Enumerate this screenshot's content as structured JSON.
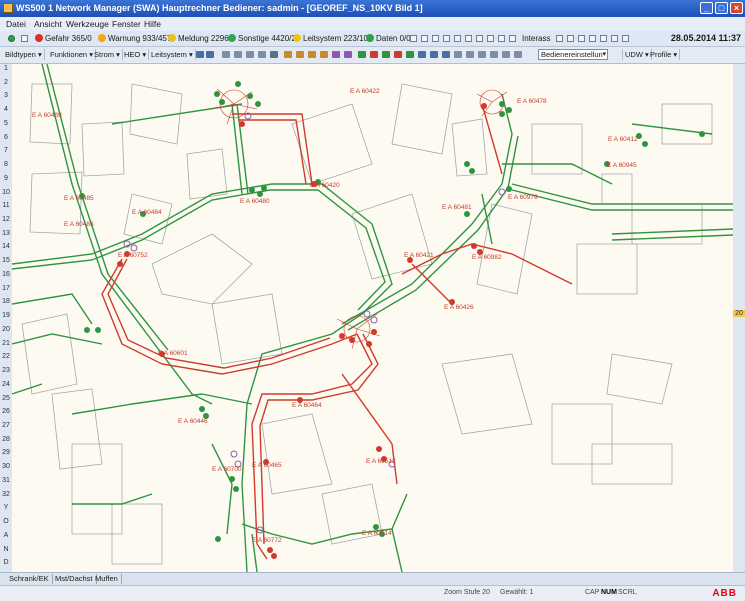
{
  "window": {
    "title": "WS500 1 Network Manager (SWA) Hauptrechner Bediener: sadmin - [GEOREF_NS_10KV     Bild 1]",
    "minimize": "_",
    "maximize": "□",
    "close": "×"
  },
  "menu": [
    "Datei",
    "Ansicht",
    "Werkzeuge",
    "Fenster",
    "Hilfe"
  ],
  "status": {
    "gefahr": "Gefahr 365/0",
    "warnung": "Warnung 933/457",
    "meldung": "Meldung 2296/0",
    "sonstige": "Sonstige 4420/2",
    "leitsystem": "Leitsystem 223/104",
    "daten": "Daten 0/0",
    "interass": "Interass",
    "datetime": "28.05.2014  11:37",
    "colors": {
      "gefahr": "#d93025",
      "warnung": "#f4a31b",
      "meldung": "#e8c21e",
      "sonstige": "#2fa84f",
      "leitsystem": "#e6c619",
      "daten": "#2f9e44"
    }
  },
  "toolbar": {
    "menus": [
      "Bildtypen",
      "Funktionen",
      "Strom",
      "HEO",
      "Leitsystem"
    ],
    "select_value": "Bedienereinstellun",
    "udw": "UDW",
    "profile": "Profile"
  },
  "ruler": {
    "left": [
      "1",
      "2",
      "3",
      "4",
      "5",
      "6",
      "7",
      "8",
      "9",
      "10",
      "11",
      "12",
      "13",
      "14",
      "15",
      "16",
      "17",
      "18",
      "19",
      "20",
      "21",
      "22",
      "23",
      "24",
      "25",
      "26",
      "27",
      "28",
      "29",
      "30",
      "31",
      "32",
      "Y",
      "O",
      "A",
      "N",
      "D"
    ],
    "right": [
      "20"
    ]
  },
  "map": {
    "labels": [
      {
        "text": "E A 60422"
      },
      {
        "text": "E A 60478"
      },
      {
        "text": "E A 60489"
      },
      {
        "text": "E A 60420"
      },
      {
        "text": "E A 60945"
      },
      {
        "text": "E A 60485"
      },
      {
        "text": "E A 60486"
      },
      {
        "text": "E A 60484"
      },
      {
        "text": "E A 60480"
      },
      {
        "text": "E A 60481"
      },
      {
        "text": "E A 60979"
      },
      {
        "text": "E A 60421"
      },
      {
        "text": "E A 60982"
      },
      {
        "text": "E A 60752"
      },
      {
        "text": "E A 60426"
      },
      {
        "text": "E A 60601"
      },
      {
        "text": "E A 60464"
      },
      {
        "text": "E A 60465"
      },
      {
        "text": "E A 60700"
      },
      {
        "text": "E A 60772"
      },
      {
        "text": "E A 60514"
      },
      {
        "text": "E A 60512"
      },
      {
        "text": "E A 60446"
      },
      {
        "text": "E A 60412"
      }
    ],
    "colors": {
      "green": "#2e9440",
      "red": "#d03a2c",
      "violet": "#8e5fb0",
      "building": "#9aa0a6"
    }
  },
  "bottom_tabs": [
    "Schrank/EK",
    "Mst/Dachst",
    "Muffen"
  ],
  "infobar": {
    "zoom": "Zoom Stufe 20",
    "grade": "Gewählt: 1",
    "cap": "CAP",
    "num": "NUM",
    "scrl": "SCRL",
    "brand": "ABB"
  }
}
